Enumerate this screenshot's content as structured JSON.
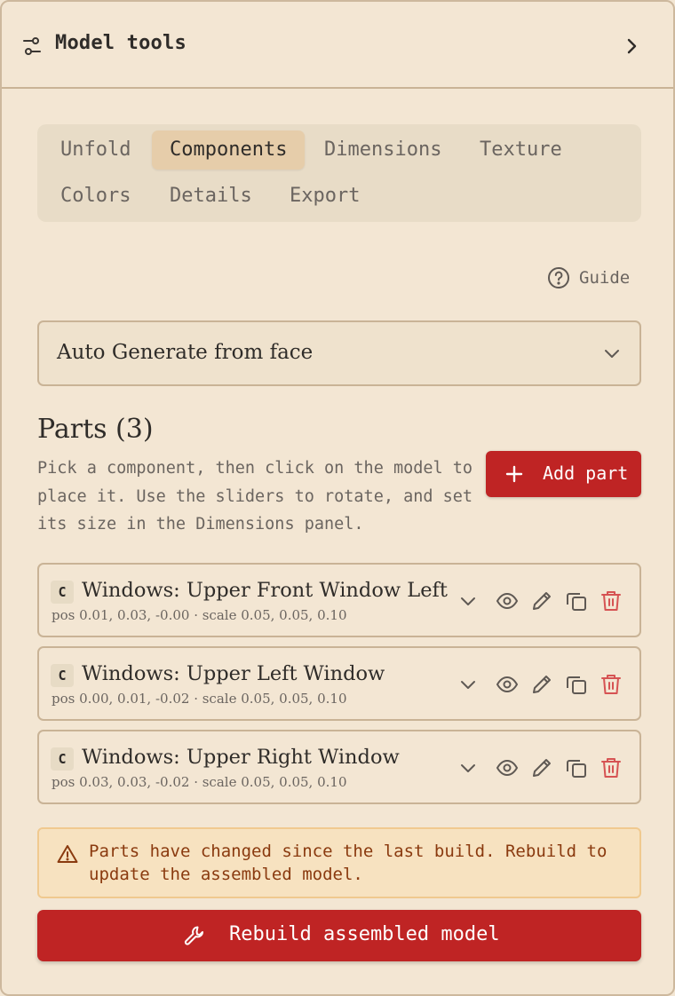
{
  "header": {
    "title": "Model tools",
    "icon": "sliders-icon",
    "expand_icon": "chevron-right-icon"
  },
  "tabs": [
    {
      "label": "Unfold",
      "active": false
    },
    {
      "label": "Components",
      "active": true
    },
    {
      "label": "Dimensions",
      "active": false
    },
    {
      "label": "Texture",
      "active": false
    },
    {
      "label": "Colors",
      "active": false
    },
    {
      "label": "Details",
      "active": false
    },
    {
      "label": "Export",
      "active": false
    }
  ],
  "guide": {
    "label": "Guide",
    "icon": "help-circle-icon"
  },
  "generator_select": {
    "value": "Auto Generate from face"
  },
  "parts": {
    "title": "Parts (3)",
    "description": "Pick a component, then click on the model to place it. Use the sliders to rotate, and set its size in the Dimensions panel.",
    "add_button": "Add part",
    "items": [
      {
        "badge": "C",
        "name": "Windows: Upper Front Window Left",
        "meta": "pos 0.01, 0.03, -0.00 · scale 0.05, 0.05, 0.10"
      },
      {
        "badge": "C",
        "name": "Windows: Upper Left Window",
        "meta": "pos 0.00, 0.01, -0.02 · scale 0.05, 0.05, 0.10"
      },
      {
        "badge": "C",
        "name": "Windows: Upper Right Window",
        "meta": "pos 0.03, 0.03, -0.02 · scale 0.05, 0.05, 0.10"
      }
    ]
  },
  "warning": {
    "text": "Parts have changed since the last build. Rebuild to update the assembled model."
  },
  "rebuild_button": "Rebuild assembled model",
  "colors": {
    "background": "#f3e6d3",
    "accent_red": "#bf2424",
    "active_tab": "#e6cdaa",
    "warning_bg": "#f7e2c0",
    "warning_text": "#8a3a0f",
    "delete_icon": "#d65353"
  }
}
